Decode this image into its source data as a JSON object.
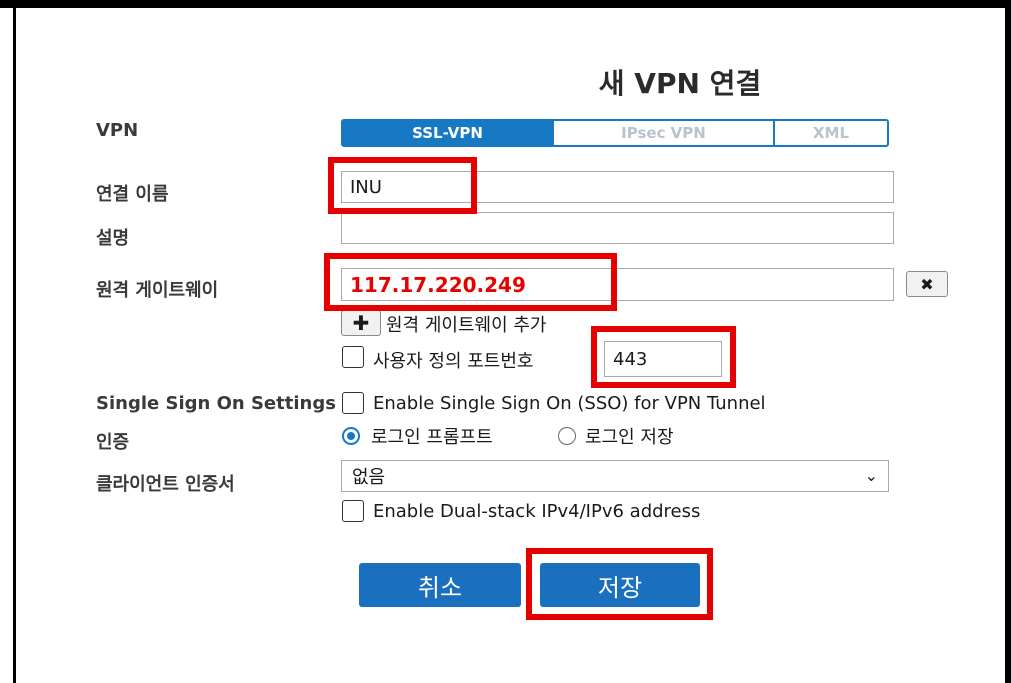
{
  "dialog": {
    "title": "새 VPN 연결"
  },
  "labels": {
    "vpn": "VPN",
    "connection_name": "연결 이름",
    "description": "설명",
    "remote_gateway": "원격 게이트웨이",
    "sso_settings": "Single Sign On Settings",
    "auth": "인증",
    "client_cert": "클라이언트 인증서"
  },
  "tabs": [
    {
      "label": "SSL-VPN",
      "active": true
    },
    {
      "label": "IPsec VPN",
      "active": false
    },
    {
      "label": "XML",
      "active": false
    }
  ],
  "fields": {
    "connection_name": "INU",
    "description": "",
    "remote_gateway": "117.17.220.249",
    "custom_port": "443"
  },
  "remote_gateway": {
    "clear_icon": "close-icon",
    "add_icon": "plus-icon",
    "add_label": "원격 게이트웨이 추가"
  },
  "custom_port": {
    "label": "사용자 정의 포트번호",
    "checked": false
  },
  "sso": {
    "label": "Enable Single Sign On (SSO) for VPN Tunnel",
    "checked": false
  },
  "auth_options": [
    {
      "label": "로그인 프롬프트",
      "checked": true
    },
    {
      "label": "로그인 저장",
      "checked": false
    }
  ],
  "client_cert": {
    "selected": "없음"
  },
  "dual_stack": {
    "label": "Enable Dual-stack IPv4/IPv6 address",
    "checked": false
  },
  "buttons": {
    "cancel": "취소",
    "save": "저장"
  },
  "colors": {
    "accent": "#1779c4",
    "button": "#1a6fbe",
    "highlight": "#e60000"
  }
}
